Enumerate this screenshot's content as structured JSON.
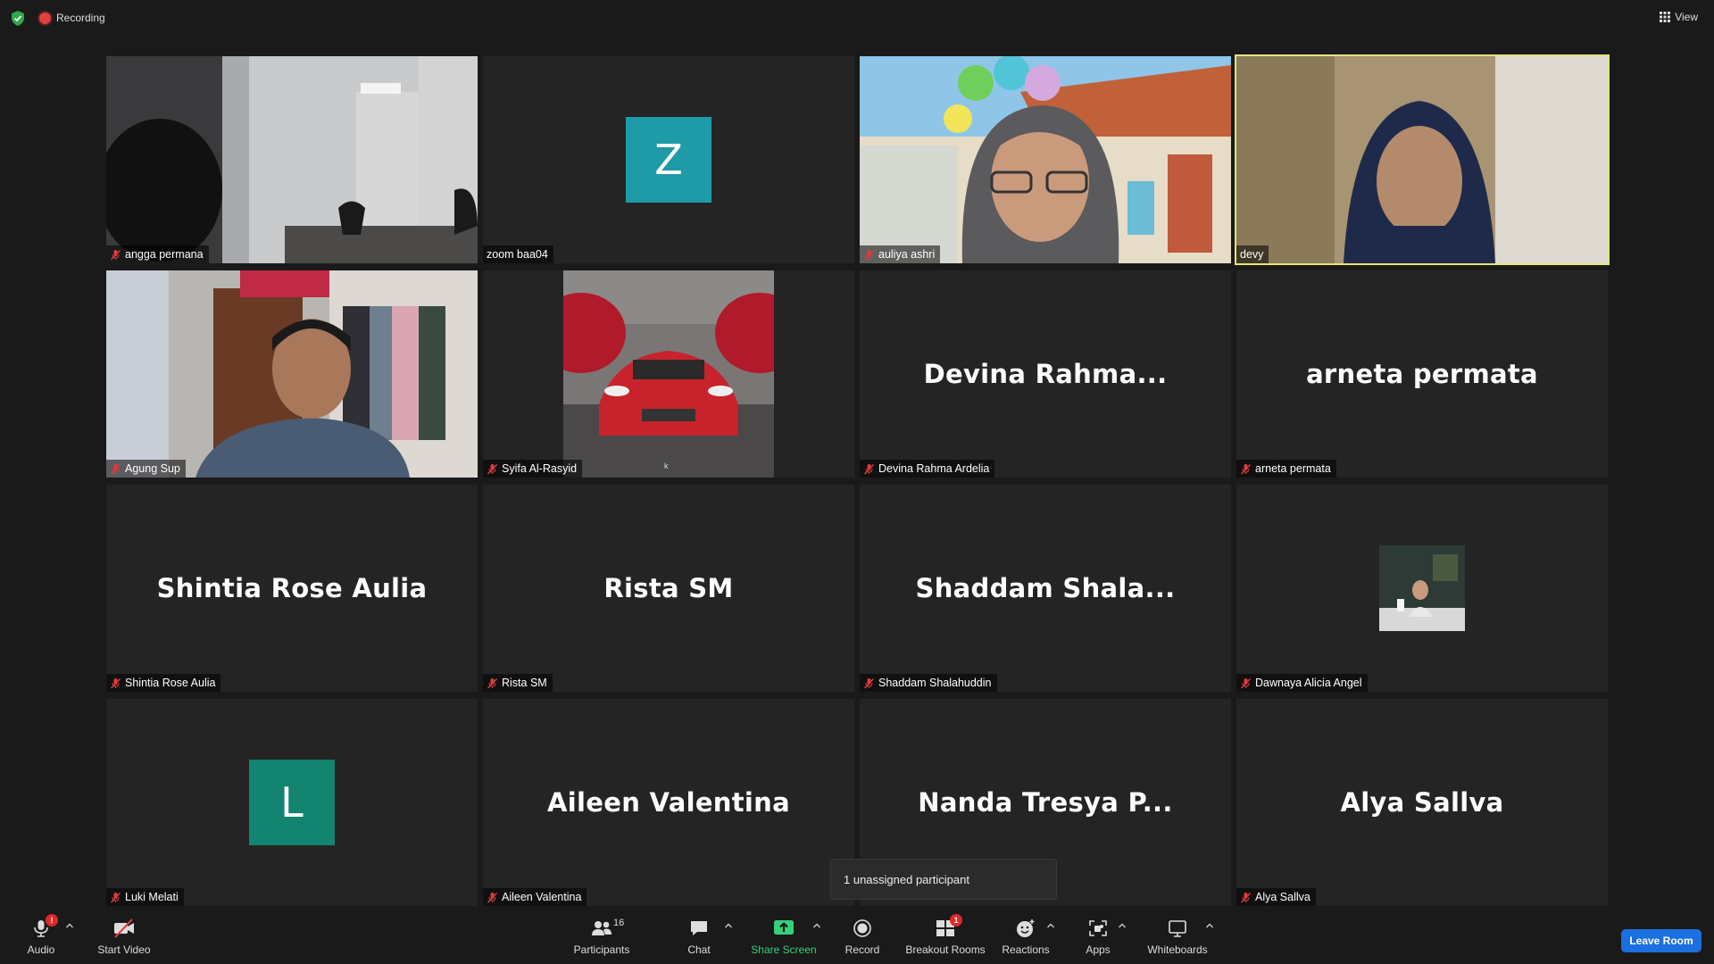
{
  "topbar": {
    "recording_label": "Recording",
    "view_label": "View",
    "shield_color": "#2ea84a",
    "record_color": "#e04040"
  },
  "tiles": [
    {
      "name": "angga permana",
      "type": "video",
      "muted": true
    },
    {
      "name": "zoom baa04",
      "type": "avatar",
      "initial": "Z",
      "avatar_color": "#1f9aa7",
      "muted": false
    },
    {
      "name": "auliya ashri",
      "type": "video",
      "muted": true
    },
    {
      "name": "devy",
      "type": "video",
      "muted": false,
      "active_speaker": true
    },
    {
      "name": "Agung Sup",
      "type": "video",
      "muted": true
    },
    {
      "name": "Syifa Al-Rasyid",
      "type": "picture",
      "muted": true,
      "picture_caption": "k"
    },
    {
      "name": "Devina Rahma Ardelia",
      "type": "name",
      "display": "Devina  Rahma...",
      "muted": true
    },
    {
      "name": "arneta permata",
      "type": "name",
      "display": "arneta permata",
      "muted": true
    },
    {
      "name": "Shintia Rose Aulia",
      "type": "name",
      "display": "Shintia Rose Aulia",
      "muted": true
    },
    {
      "name": "Rista SM",
      "type": "name",
      "display": "Rista SM",
      "muted": true
    },
    {
      "name": "Shaddam Shalahuddin",
      "type": "name",
      "display": "Shaddam  Shala...",
      "muted": true
    },
    {
      "name": "Dawnaya Alicia Angel",
      "type": "thumb",
      "muted": true
    },
    {
      "name": "Luki Melati",
      "type": "avatar",
      "initial": "L",
      "avatar_color": "#128470",
      "muted": true
    },
    {
      "name": "Aileen Valentina",
      "type": "name",
      "display": "Aileen Valentina",
      "muted": true
    },
    {
      "name": "Nanda Tresya Putri",
      "type": "name",
      "display": "Nanda  Tresya  P...",
      "muted": true,
      "label_hidden": true
    },
    {
      "name": "Alya Sallva",
      "type": "name",
      "display": "Alya Sallva",
      "muted": true
    }
  ],
  "popup": {
    "text": "1 unassigned participant"
  },
  "toolbar": {
    "audio": {
      "label": "Audio",
      "badge": "!"
    },
    "video": {
      "label": "Start Video"
    },
    "participants": {
      "label": "Participants",
      "count": "16"
    },
    "chat": {
      "label": "Chat"
    },
    "share": {
      "label": "Share Screen",
      "color": "#33d17a"
    },
    "record": {
      "label": "Record"
    },
    "breakout": {
      "label": "Breakout Rooms",
      "badge": "1"
    },
    "reactions": {
      "label": "Reactions"
    },
    "apps": {
      "label": "Apps"
    },
    "whiteboards": {
      "label": "Whiteboards"
    },
    "leave": {
      "label": "Leave Room",
      "color": "#1b6fe0"
    }
  }
}
